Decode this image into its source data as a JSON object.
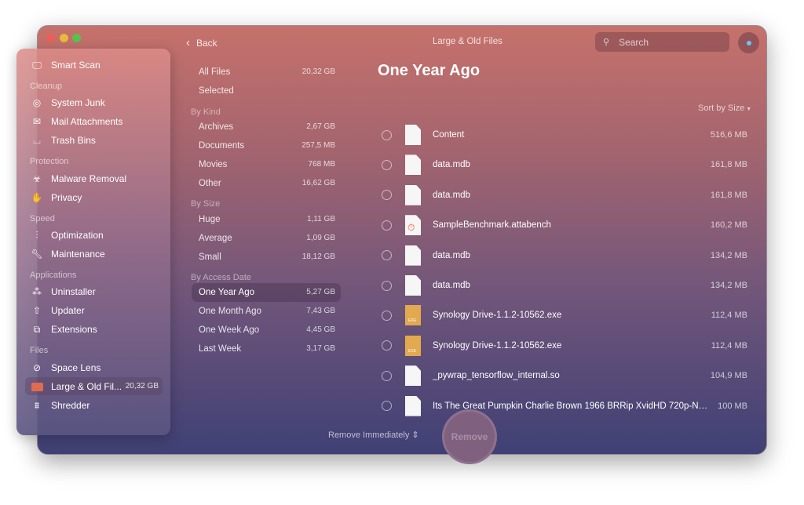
{
  "window": {
    "title": "Large & Old Files",
    "back_label": "Back",
    "search_placeholder": "Search"
  },
  "sidebar": {
    "smart_scan": "Smart Scan",
    "sections": [
      {
        "header": "Cleanup",
        "items": [
          "System Junk",
          "Mail Attachments",
          "Trash Bins"
        ]
      },
      {
        "header": "Protection",
        "items": [
          "Malware Removal",
          "Privacy"
        ]
      },
      {
        "header": "Speed",
        "items": [
          "Optimization",
          "Maintenance"
        ]
      },
      {
        "header": "Applications",
        "items": [
          "Uninstaller",
          "Updater",
          "Extensions"
        ]
      },
      {
        "header": "Files",
        "items": [
          "Space Lens",
          "Large & Old Fil...",
          "Shredder"
        ]
      }
    ],
    "active_badge": "20,32 GB"
  },
  "categories": {
    "all_files": {
      "label": "All Files",
      "value": "20,32 GB"
    },
    "selected": {
      "label": "Selected"
    },
    "by_kind": {
      "header": "By Kind",
      "items": [
        {
          "label": "Archives",
          "value": "2,67 GB"
        },
        {
          "label": "Documents",
          "value": "257,5 MB"
        },
        {
          "label": "Movies",
          "value": "768 MB"
        },
        {
          "label": "Other",
          "value": "16,62 GB"
        }
      ]
    },
    "by_size": {
      "header": "By Size",
      "items": [
        {
          "label": "Huge",
          "value": "1,11 GB"
        },
        {
          "label": "Average",
          "value": "1,09 GB"
        },
        {
          "label": "Small",
          "value": "18,12 GB"
        }
      ]
    },
    "by_access": {
      "header": "By Access Date",
      "items": [
        {
          "label": "One Year Ago",
          "value": "5,27 GB"
        },
        {
          "label": "One Month Ago",
          "value": "7,43 GB"
        },
        {
          "label": "One Week Ago",
          "value": "4,45 GB"
        },
        {
          "label": "Last Week",
          "value": "3,17 GB"
        }
      ]
    }
  },
  "main": {
    "title": "One Year Ago",
    "sort_label": "Sort by Size",
    "files": [
      {
        "name": "Content",
        "size": "516,6 MB",
        "icon": "doc"
      },
      {
        "name": "data.mdb",
        "size": "161,8 MB",
        "icon": "doc"
      },
      {
        "name": "data.mdb",
        "size": "161,8 MB",
        "icon": "doc"
      },
      {
        "name": "SampleBenchmark.attabench",
        "size": "160,2 MB",
        "icon": "att"
      },
      {
        "name": "data.mdb",
        "size": "134,2 MB",
        "icon": "doc"
      },
      {
        "name": "data.mdb",
        "size": "134,2 MB",
        "icon": "doc"
      },
      {
        "name": "Synology Drive-1.1.2-10562.exe",
        "size": "112,4 MB",
        "icon": "exe"
      },
      {
        "name": "Synology Drive-1.1.2-10562.exe",
        "size": "112,4 MB",
        "icon": "exe"
      },
      {
        "name": "_pywrap_tensorflow_internal.so",
        "size": "104,9 MB",
        "icon": "doc"
      },
      {
        "name": "Its The Great Pumpkin Charlie Brown 1966 BRRip XvidHD 720p-NP...",
        "size": "100 MB",
        "icon": "doc"
      }
    ]
  },
  "footer": {
    "remove_mode": "Remove Immediately",
    "remove_label": "Remove"
  }
}
